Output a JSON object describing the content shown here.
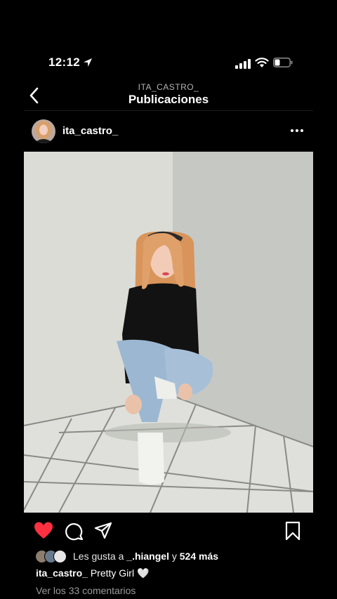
{
  "status_bar": {
    "time": "12:12"
  },
  "header": {
    "account": "ITA_CASTRO_",
    "title": "Publicaciones"
  },
  "post": {
    "username": "ita_castro_",
    "likes": {
      "prefix": "Les gusta a ",
      "user": "_.hiangel",
      "connector": " y ",
      "others": "524 más"
    },
    "caption": {
      "username": "ita_castro_",
      "text": "Pretty Girl",
      "emoji": "🤍"
    },
    "comments_link": "Ver los 33 comentarios"
  },
  "icons": {
    "back": "chevron-left-icon",
    "more": "more-dots-icon",
    "like": "heart-icon",
    "comment": "comment-icon",
    "share": "send-icon",
    "save": "bookmark-icon"
  },
  "colors": {
    "like_active": "#ff3040",
    "background": "#000000",
    "secondary_text": "#9a9a9a"
  }
}
